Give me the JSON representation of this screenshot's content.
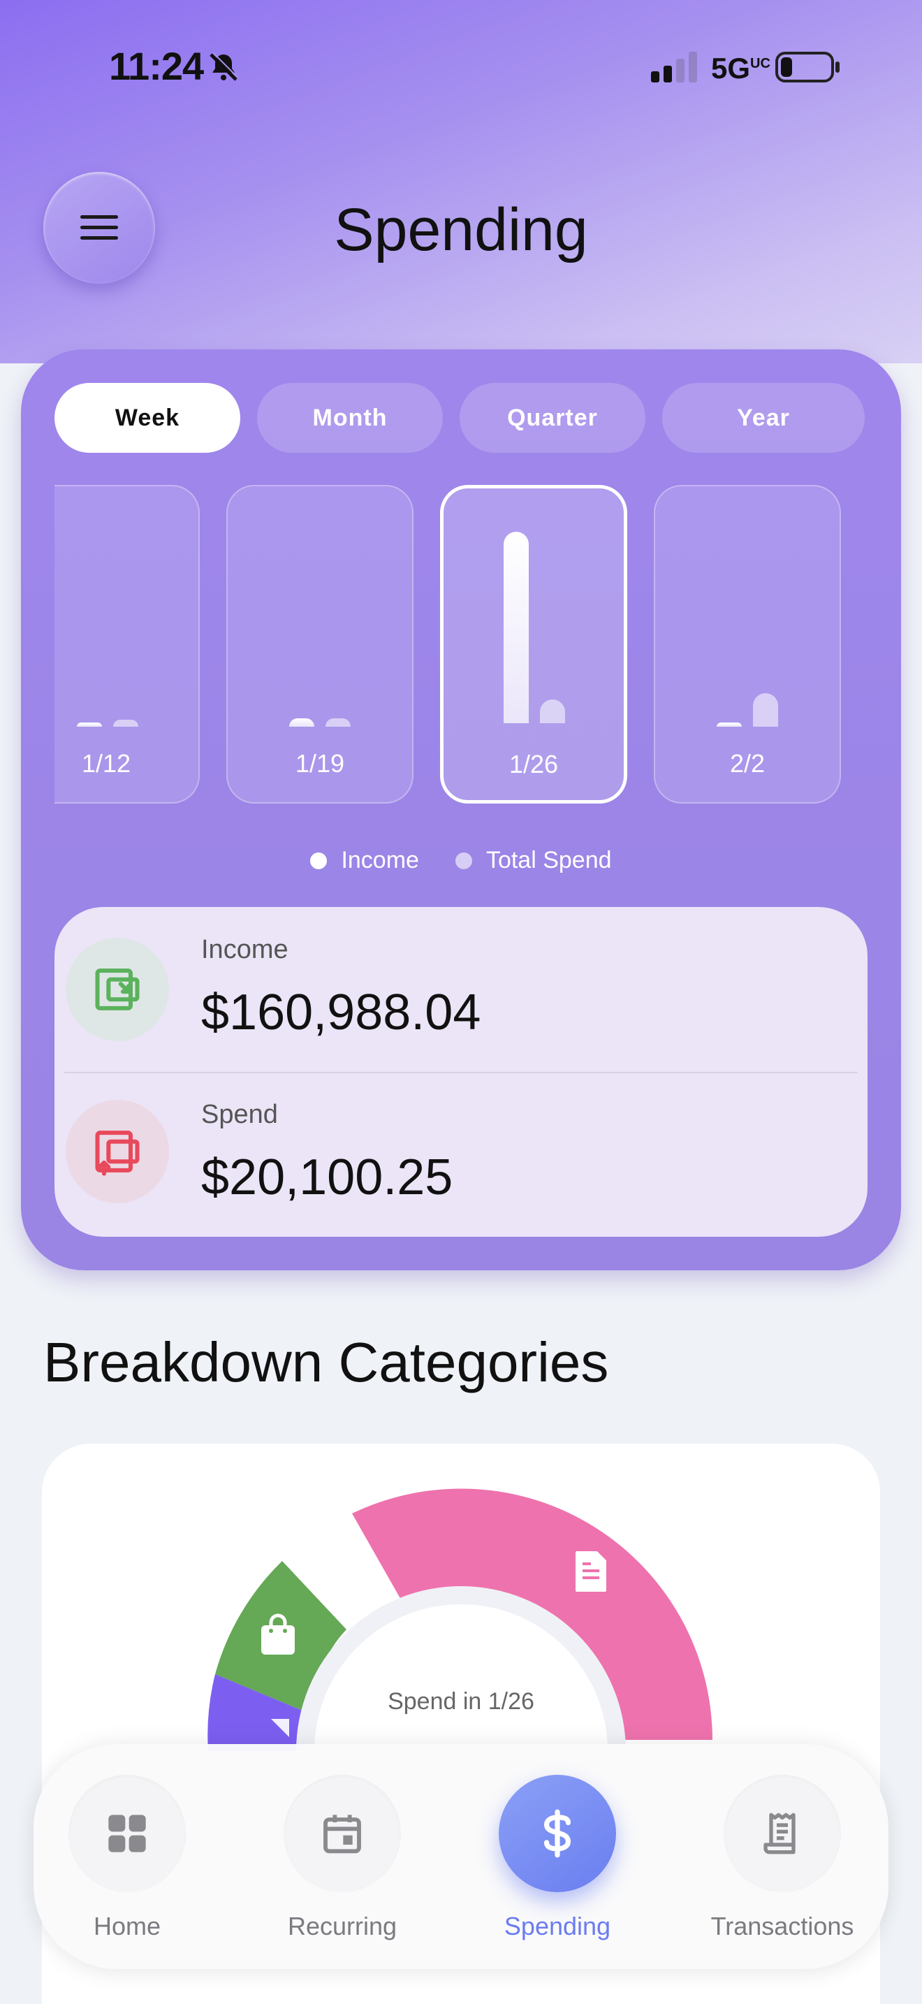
{
  "status_bar": {
    "time": "11:24",
    "network": "5G",
    "network_suffix": "UC"
  },
  "header": {
    "title": "Spending"
  },
  "period_tabs": [
    {
      "label": "Week",
      "active": true
    },
    {
      "label": "Month",
      "active": false
    },
    {
      "label": "Quarter",
      "active": false
    },
    {
      "label": "Year",
      "active": false
    }
  ],
  "weeks": [
    {
      "label": "1/12",
      "selected": false
    },
    {
      "label": "1/19",
      "selected": false
    },
    {
      "label": "1/26",
      "selected": true
    },
    {
      "label": "2/2",
      "selected": false
    }
  ],
  "legend": {
    "income": "Income",
    "spend": "Total Spend"
  },
  "totals": {
    "income_label": "Income",
    "income_value": "$160,988.04",
    "spend_label": "Spend",
    "spend_value": "$20,100.25"
  },
  "breakdown": {
    "title": "Breakdown Categories",
    "center_text": "Spend in 1/26"
  },
  "nav": [
    {
      "label": "Home",
      "icon": "grid-icon",
      "active": false
    },
    {
      "label": "Recurring",
      "icon": "calendar-icon",
      "active": false
    },
    {
      "label": "Spending",
      "icon": "dollar-icon",
      "active": true
    },
    {
      "label": "Transactions",
      "icon": "receipt-icon",
      "active": false
    }
  ],
  "colors": {
    "accent": "#6b7cf0",
    "bills": "#ee72ad",
    "shopping": "#65a856",
    "other": "#7c5ff0",
    "income_icon": "#5bb25c",
    "spend_icon": "#e8495b"
  }
}
